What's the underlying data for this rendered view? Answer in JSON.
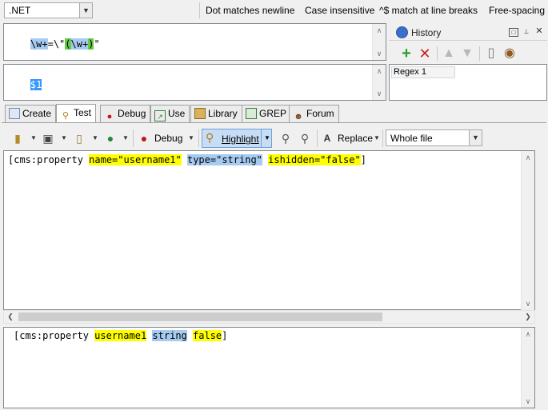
{
  "options": {
    "flavor": ".NET",
    "dot_matches_newline": "Dot matches newline",
    "case_insensitive": "Case insensitive",
    "line_breaks": "^$ match at line breaks",
    "free_spacing": "Free-spacing"
  },
  "regex": {
    "tokens": [
      "\\w+",
      "=\\\"",
      "(",
      "\\w+",
      ")",
      "\""
    ],
    "replacement": "$1"
  },
  "history": {
    "title": "History",
    "items": [
      "Regex 1"
    ]
  },
  "tabs": [
    {
      "label": "Create",
      "icon": "create-icon"
    },
    {
      "label": "Test",
      "icon": "magnifier-icon"
    },
    {
      "label": "Debug",
      "icon": "bug-icon"
    },
    {
      "label": "Use",
      "icon": "use-icon"
    },
    {
      "label": "Library",
      "icon": "library-icon"
    },
    {
      "label": "GREP",
      "icon": "grep-icon"
    },
    {
      "label": "Forum",
      "icon": "forum-icon"
    }
  ],
  "toolbar": {
    "debug_label": "Debug",
    "highlight_label": "Highlight",
    "replace_label": "Replace",
    "scope": "Whole file"
  },
  "subject": {
    "prefix": "[cms:property ",
    "m1": "name=\"username1\"",
    "m2": "type=\"string\"",
    "m3": "ishidden=\"false\"",
    "suffix": "]"
  },
  "result": {
    "prefix": "[cms:property ",
    "m1": "username1",
    "m2": "string",
    "m3": "false",
    "suffix": "]"
  },
  "colors": {
    "match_yellow": "#ffff00",
    "match_blue": "#a6caf0",
    "group_green": "#66cc44"
  }
}
